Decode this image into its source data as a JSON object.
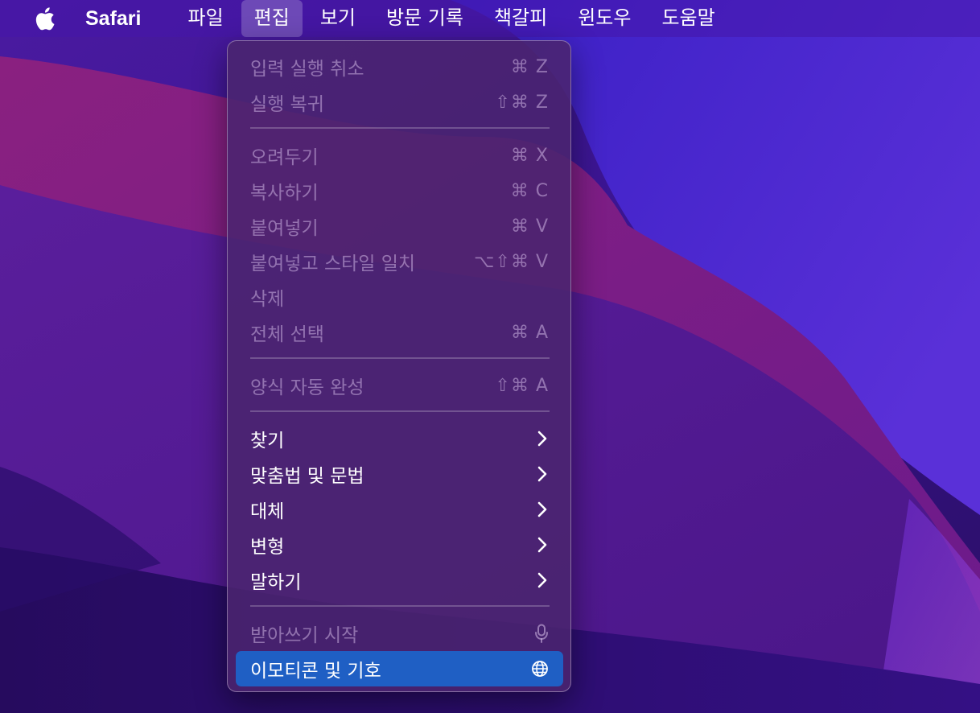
{
  "menubar": {
    "app_name": "Safari",
    "items": [
      {
        "label": "파일"
      },
      {
        "label": "편집",
        "active": true
      },
      {
        "label": "보기"
      },
      {
        "label": "방문 기록"
      },
      {
        "label": "책갈피"
      },
      {
        "label": "윈도우"
      },
      {
        "label": "도움말"
      }
    ]
  },
  "edit_menu": {
    "items": [
      {
        "label": "입력 실행 취소",
        "shortcut": "⌘ Z",
        "enabled": false
      },
      {
        "label": "실행 복귀",
        "shortcut": "⇧⌘ Z",
        "enabled": false
      },
      {
        "label": "오려두기",
        "shortcut": "⌘ X",
        "enabled": false
      },
      {
        "label": "복사하기",
        "shortcut": "⌘ C",
        "enabled": false
      },
      {
        "label": "붙여넣기",
        "shortcut": "⌘ V",
        "enabled": false
      },
      {
        "label": "붙여넣고 스타일 일치",
        "shortcut": "⌥⇧⌘ V",
        "enabled": false
      },
      {
        "label": "삭제",
        "shortcut": "",
        "enabled": false
      },
      {
        "label": "전체 선택",
        "shortcut": "⌘ A",
        "enabled": false
      },
      {
        "label": "양식 자동 완성",
        "shortcut": "⇧⌘ A",
        "enabled": false
      },
      {
        "label": "찾기",
        "submenu": true,
        "enabled": true
      },
      {
        "label": "맞춤법 및 문법",
        "submenu": true,
        "enabled": true
      },
      {
        "label": "대체",
        "submenu": true,
        "enabled": true
      },
      {
        "label": "변형",
        "submenu": true,
        "enabled": true
      },
      {
        "label": "말하기",
        "submenu": true,
        "enabled": true
      },
      {
        "label": "받아쓰기 시작",
        "icon": "microphone-icon",
        "enabled": false
      },
      {
        "label": "이모티콘 및 기호",
        "icon": "globe-icon",
        "enabled": true,
        "highlighted": true
      }
    ]
  },
  "colors": {
    "menubar_bg": "#4a1aa8",
    "menu_bg": "#4a246e",
    "highlight": "#1f5fc4",
    "wallpaper_dark": "#2c0f6e",
    "wallpaper_magenta": "#7a1a78",
    "wallpaper_blue": "#3a24c8"
  }
}
